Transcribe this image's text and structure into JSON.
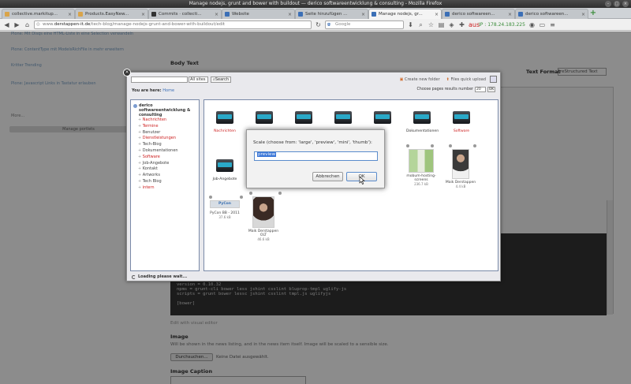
{
  "window": {
    "title": "Manage nodejs, grunt and bower with buildout — derico softwareentwicklung & consulting - Mozilla Firefox",
    "controls": [
      "–",
      "□",
      "×"
    ]
  },
  "tabs": [
    {
      "label": "collective.markitup...",
      "color": "#d9a44a",
      "active": false
    },
    {
      "label": "Products.EasyNew...",
      "color": "#d9a44a",
      "active": false
    },
    {
      "label": "Commits · collecti...",
      "color": "#333333",
      "active": false
    },
    {
      "label": "Website",
      "color": "#3b6fb6",
      "active": false
    },
    {
      "label": "Seite hinzufügen ...",
      "color": "#3b6fb6",
      "active": false
    },
    {
      "label": "Manage nodejs, gr...",
      "color": "#3b6fb6",
      "active": true
    },
    {
      "label": "derico softwareen...",
      "color": "#3b6fb6",
      "active": false
    },
    {
      "label": "derico softwareen...",
      "color": "#3b6fb6",
      "active": false
    }
  ],
  "navbar": {
    "url_prefix": "www.",
    "url_domain": "derstappen-it.de",
    "url_path": "/tech-blog/manage-nodejs-grunt-and-bower-with-buildout/edit",
    "search_placeholder": "Google",
    "ip_text": "IP : 178.24.183.225",
    "aus_label": "aus"
  },
  "sidebar": {
    "items": [
      "Plone: Mit Disqs eine HTML-Liste in eine Selection verwandeln",
      "Plone: ContentType mit ModelsRichFile in mehr erweitern",
      "Kritter Trending",
      "Plone: Javascript Links in Tastatur erlauben"
    ],
    "more": "More...",
    "manage_button": "Manage portlets"
  },
  "form": {
    "body_text_label": "Body Text",
    "text_format_label": "Text Format",
    "text_format_value": "reStructured Text",
    "code_lines": "version = 0.10.32\nnpms = grunt-cli bower less jshint csslint bluprop-tmpl uglify-js\nscripts = grunt bower lessc jshint csslint tmpl.js uglifyjs\n\n[bower]",
    "visual_editor_link": "Edit with visual editor",
    "image_label": "Image",
    "image_desc": "Will be shown in the news listing, and in the news item itself. Image will be scaled to a sensible size.",
    "browse_button": "Durchsuchen...",
    "no_file": "Keine Datei ausgewählt.",
    "caption_label": "Image Caption"
  },
  "browser": {
    "scope_value": "All sites",
    "search_button": "Search",
    "link_create_folder": "Create new folder",
    "link_upload": "Files quick upload",
    "youarehere_label": "You are here:",
    "youarehere_value": "Home",
    "pager_label": "Choose pages results number",
    "pager_value": "20",
    "pager_ok": "OK",
    "tree_root": "derico softwareentwicklung & consulting",
    "tree_items": [
      {
        "label": "Nachrichten",
        "red": true
      },
      {
        "label": "Termine",
        "red": true
      },
      {
        "label": "Benutzer",
        "red": false
      },
      {
        "label": "Dienstleistungen",
        "red": true
      },
      {
        "label": "Tech-Blog",
        "red": false
      },
      {
        "label": "Dokumentationen",
        "red": false
      },
      {
        "label": "Software",
        "red": true
      },
      {
        "label": "Job-Angebote",
        "red": false
      },
      {
        "label": "Kontakt",
        "red": false
      },
      {
        "label": "Artworks",
        "red": false
      },
      {
        "label": "Tech Blog",
        "red": false
      },
      {
        "label": "intern",
        "red": true
      }
    ],
    "folders_row1": [
      {
        "label": "Nachrichten",
        "red": true
      },
      {
        "label": "",
        "red": false
      },
      {
        "label": "",
        "red": false
      },
      {
        "label": "",
        "red": false
      },
      {
        "label": "",
        "red": false
      },
      {
        "label": "Dokumentationen",
        "red": false
      },
      {
        "label": "Software",
        "red": true
      }
    ],
    "folder_row2_label": "Job-Angebote",
    "thumbs_right": [
      {
        "label": "mobum-hosting-screens",
        "size": "236.7 kB"
      },
      {
        "label": "Maik Derstappen",
        "size": "4.4 kB"
      }
    ],
    "thumbs_bottom": [
      {
        "label": "PyCon BB - 2011",
        "size": "37.6 kB",
        "badge": "PyCon"
      },
      {
        "label": "Maik Derstappen OLT",
        "size": "46.6 kB"
      }
    ],
    "status": "Loading please wait..."
  },
  "prompt": {
    "message": "Scale (choose from: 'large', 'preview', 'mini', 'thumb'):",
    "value": "preview",
    "cancel": "Abbrechen",
    "ok": "OK"
  }
}
